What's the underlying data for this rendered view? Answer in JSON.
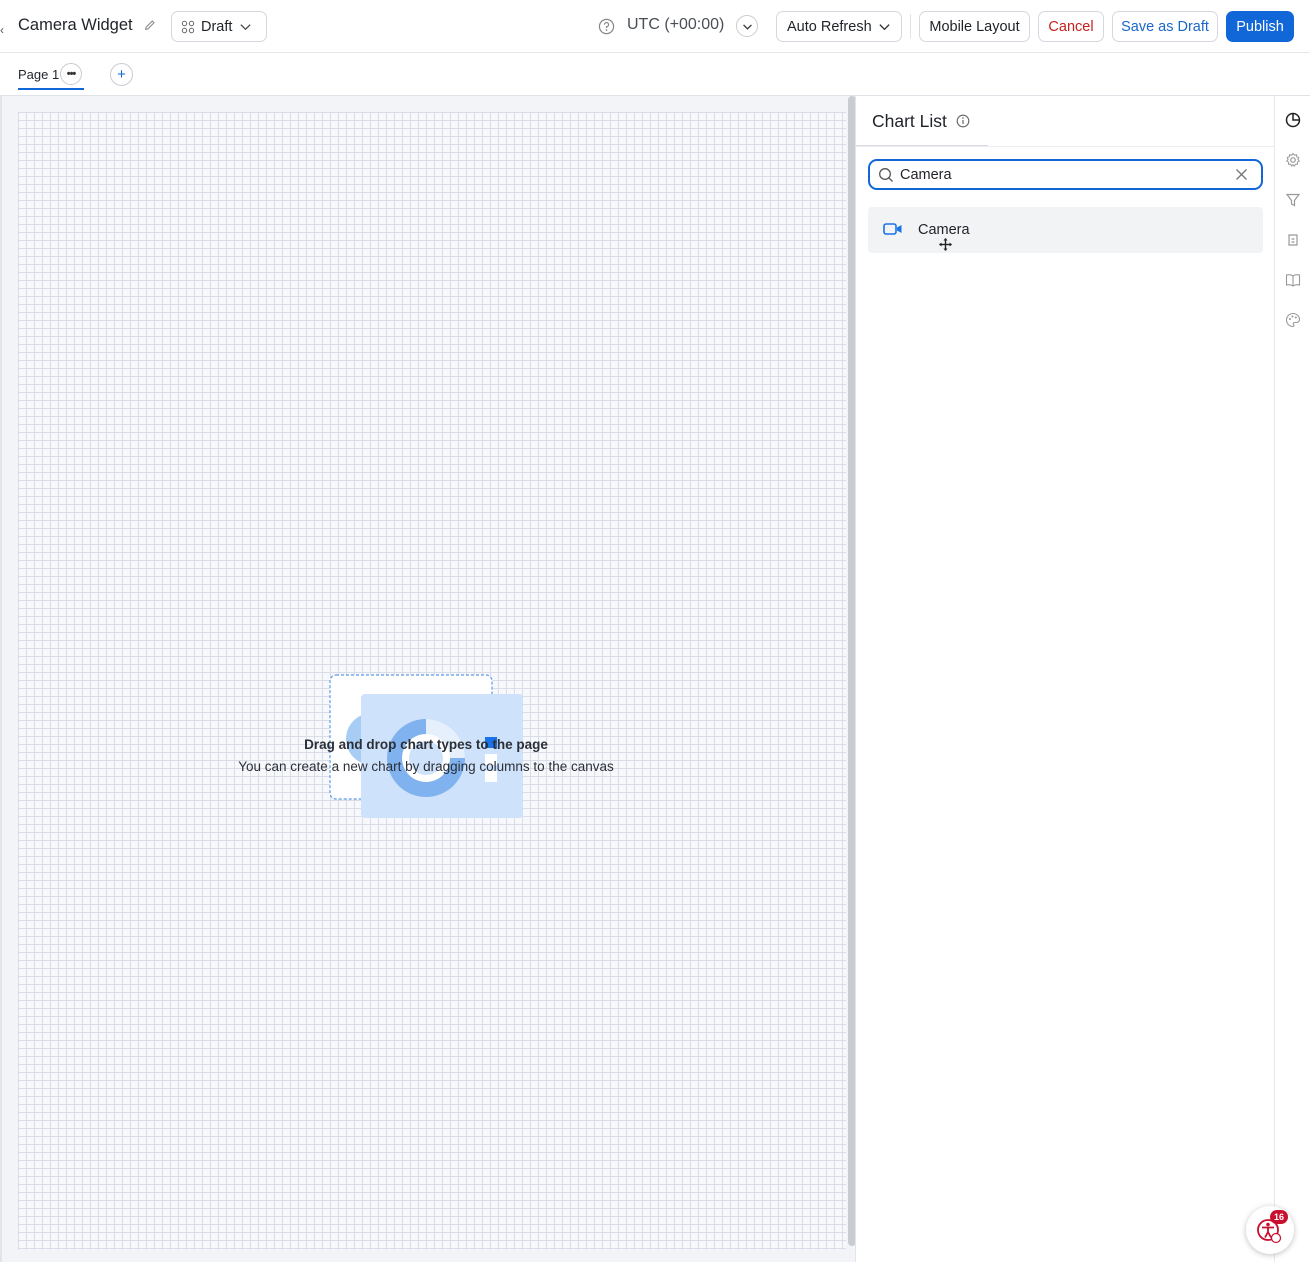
{
  "header": {
    "title": "Camera Widget",
    "status_label": "Draft",
    "timezone": "UTC (+00:00)",
    "auto_refresh_label": "Auto Refresh",
    "mobile_layout_label": "Mobile Layout",
    "cancel_label": "Cancel",
    "save_draft_label": "Save as Draft",
    "publish_label": "Publish"
  },
  "pages": {
    "tabs": [
      {
        "label": "Page 1",
        "active": true
      }
    ],
    "more_label": "•••",
    "add_label": "+"
  },
  "canvas": {
    "empty_title": "Drag and drop chart types to the page",
    "empty_subtitle": "You can create a new chart by dragging columns to the canvas"
  },
  "chart_list": {
    "title": "Chart List",
    "search_value": "Camera",
    "results": [
      {
        "label": "Camera",
        "icon": "video-camera-icon"
      }
    ]
  },
  "rail": {
    "icons": [
      "chart-icon",
      "gear-icon",
      "filter-icon",
      "data-icon",
      "book-icon",
      "palette-icon"
    ]
  },
  "a11y": {
    "badge_count": "16"
  },
  "colors": {
    "primary": "#1166d8",
    "danger": "#c5221f",
    "grid_line": "#dadde8"
  }
}
